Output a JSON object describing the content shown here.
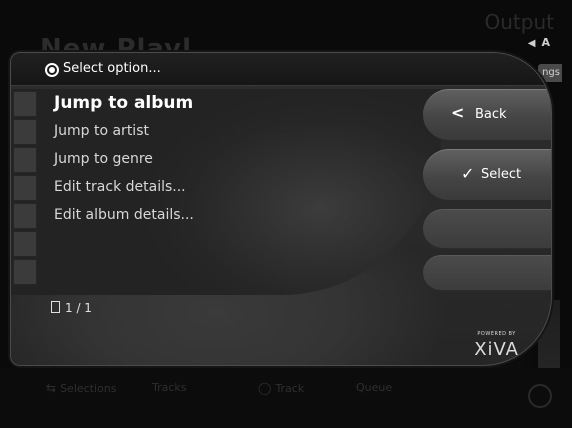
{
  "background": {
    "title": "New Playl",
    "output_label": "Output",
    "volume": "A",
    "settings_tab": "ngs",
    "bottom_bar": {
      "items": [
        "Selections",
        "Tracks",
        "Track",
        "Queue"
      ]
    }
  },
  "dialog": {
    "title": "Select option...",
    "options": [
      {
        "label": "Jump to album",
        "selected": true
      },
      {
        "label": "Jump to artist"
      },
      {
        "label": "Jump to genre"
      },
      {
        "label": "Edit track details..."
      },
      {
        "label": "Edit album details..."
      }
    ],
    "buttons": {
      "back": {
        "label": "Back",
        "icon": "chevron-left-icon"
      },
      "select": {
        "label": "Select",
        "icon": "checkmark-icon"
      }
    },
    "page_indicator": "1 / 1",
    "brand": {
      "powered_by": "POWERED BY",
      "logo": "XiVA"
    }
  }
}
